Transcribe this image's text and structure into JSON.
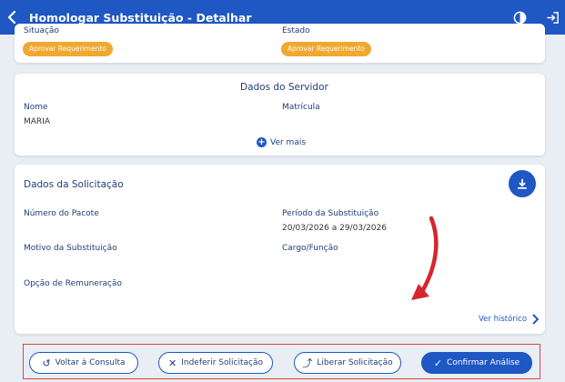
{
  "header": {
    "title": "Homologar Substituição - Detalhar"
  },
  "card_status": {
    "situacao_label": "Situação",
    "situacao_value": "Aprovar Requerimento",
    "estado_label": "Estado",
    "estado_value": "Aprovar Requerimento"
  },
  "servidor": {
    "title": "Dados do Servidor",
    "nome_label": "Nome",
    "nome_value": "MARIA",
    "matricula_label": "Matrícula",
    "ver_mais": "Ver mais"
  },
  "solicitacao": {
    "title": "Dados da Solicitação",
    "numero_pacote_label": "Número do Pacote",
    "periodo_label": "Período da Substituição",
    "periodo_value": "20/03/2026 a 29/03/2026",
    "motivo_label": "Motivo da Substituição",
    "cargo_label": "Cargo/Função",
    "opcao_label": "Opção de Remuneração",
    "ver_historico": "Ver histórico"
  },
  "actions": {
    "voltar": "Voltar à Consulta",
    "indeferir": "Indeferir Solicitação",
    "liberar": "Liberar Solicitação",
    "confirmar": "Confirmar Análise"
  },
  "colors": {
    "primary": "#1f57c3",
    "badge": "#f0a830",
    "highlight": "#e0433a"
  }
}
